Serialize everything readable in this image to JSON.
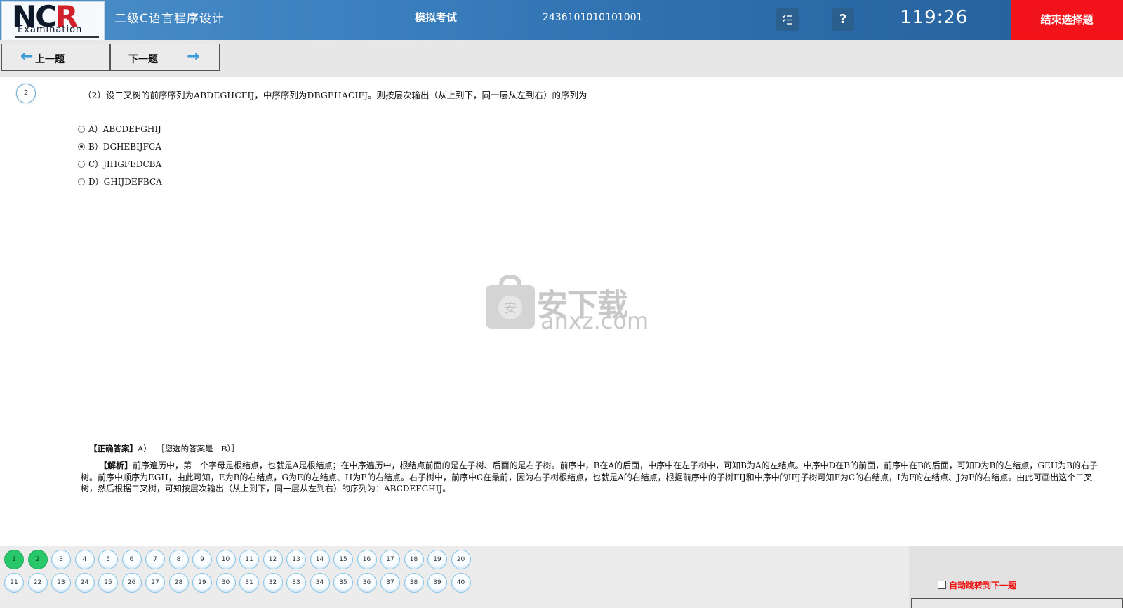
{
  "header": {
    "logo_text": "NCR",
    "logo_sub": "Examination",
    "subject": "二级C语言程序设计",
    "mode": "模拟考试",
    "exam_id": "2436101010101001",
    "list_icon": "list-icon",
    "help_label": "?",
    "timer": "119:26",
    "end_label": "结束选择题"
  },
  "nav": {
    "prev_label": "上一题",
    "next_label": "下一题",
    "prev_icon": "←",
    "next_icon": "→"
  },
  "question": {
    "number": "2",
    "text": "（2）设二叉树的前序序列为ABDEGHCFIJ，中序序列为DBGEHACIFJ。则按层次输出（从上到下，同一层从左到右）的序列为",
    "options": [
      {
        "label": "A）ABCDEFGHIJ",
        "selected": false
      },
      {
        "label": "B）DGHEBIJFCA",
        "selected": true
      },
      {
        "label": "C）JIHGFEDCBA",
        "selected": false
      },
      {
        "label": "D）GHIJDEFBCA",
        "selected": false
      }
    ]
  },
  "watermark": {
    "text": "安下载",
    "sub": "anxz.com"
  },
  "answer": {
    "correct_tag": "【正确答案】",
    "correct_value": "A）",
    "your_answer": "［您选的答案是：B）］",
    "analysis_tag": "【解析】",
    "analysis": "前序遍历中，第一个字母是根结点，也就是A是根结点；在中序遍历中，根结点前面的是左子树、后面的是右子树。前序中，B在A的后面，中序中在左子树中，可知B为A的左结点。中序中D在B的前面，前序中在B的后面，可知D为B的左结点，GEH为B的右子树。前序中顺序为EGH，由此可知，E为B的右结点，G为E的左结点、H为E的右结点。右子树中，前序中C在最前，因为右子树根结点，也就是A的右结点，根据前序中的子树FIJ和中序中的IFJ子树可知F为C的右结点，I为F的左结点、J为F的右结点。由此可画出这个二叉树，然后根据二叉树，可知按层次输出（从上到下，同一层从左到右）的序列为：ABCDEFGHIJ。"
  },
  "question_grid": {
    "answered": [
      "1",
      "2"
    ],
    "row1": [
      "1",
      "2",
      "3",
      "4",
      "5",
      "6",
      "7",
      "8",
      "9",
      "10",
      "11",
      "12",
      "13",
      "14",
      "15",
      "16",
      "17",
      "18",
      "19",
      "20"
    ],
    "row2": [
      "21",
      "22",
      "23",
      "24",
      "25",
      "26",
      "27",
      "28",
      "29",
      "30",
      "31",
      "32",
      "33",
      "34",
      "35",
      "36",
      "37",
      "38",
      "39",
      "40"
    ]
  },
  "auto_jump_label": "自动跳转到下一题",
  "colors": {
    "end_button": "#f2121a",
    "answered": "#27c76a",
    "auto_label": "#e11111"
  }
}
